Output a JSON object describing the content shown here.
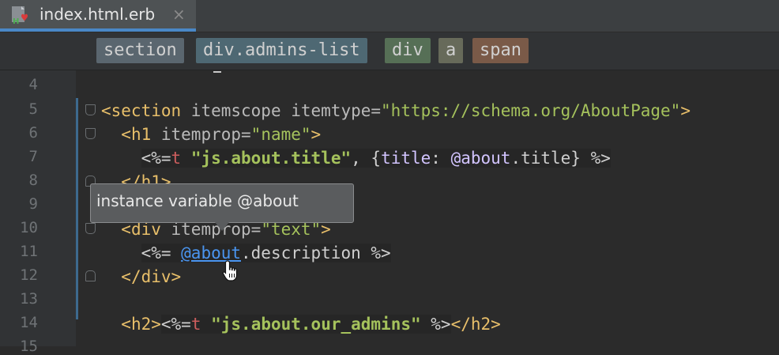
{
  "tab": {
    "title": "index.html.erb",
    "close": "×",
    "icon": "erb-file-icon"
  },
  "breadcrumbs": [
    {
      "label": "section",
      "bg": "#5a666f"
    },
    {
      "label": "div.admins-list",
      "bg": "#4e6873"
    },
    {
      "label": "div",
      "bg": "#566f56"
    },
    {
      "label": "a",
      "bg": "#676a5a"
    },
    {
      "label": "span",
      "bg": "#7a5a48"
    }
  ],
  "line_numbers": [
    "4",
    "5",
    "6",
    "7",
    "8",
    "9",
    "10",
    "11",
    "12",
    "13",
    "14",
    "15"
  ],
  "code": {
    "l5": {
      "open": "<section",
      "attr": " itemscope itemtype=",
      "val": "\"https://schema.org/AboutPage\"",
      "close": ">"
    },
    "l6": {
      "indent": "  ",
      "open": "<h1",
      "attr": " itemprop=",
      "val": "\"name\"",
      "close": ">"
    },
    "l7": {
      "indent": "    ",
      "erb_open": "<%=",
      "method": "t",
      "sp": " ",
      "str": "\"js.about.title\"",
      "comma": ", {",
      "key": "title",
      "colon": ": ",
      "ivar": "@about",
      "dot": ".title}",
      "erb_close": " %>"
    },
    "l8": {
      "indent": "  ",
      "text": "</h1>"
    },
    "l10": {
      "indent": "  ",
      "open": "<div",
      "attr": " itemprop=",
      "val": "\"text\"",
      "close": ">"
    },
    "l11": {
      "indent": "    ",
      "erb_open": "<%= ",
      "ivar": "@about",
      "rest": ".description ",
      "erb_close": "%>"
    },
    "l12": {
      "indent": "  ",
      "text": "</div>"
    },
    "l14": {
      "indent": "  ",
      "open": "<h2>",
      "erb_open": "<%=",
      "method": "t",
      "sp": " ",
      "str": "\"js.about.our_admins\"",
      "erb_close": " %>",
      "close": "</h2>"
    }
  },
  "tooltip": {
    "text": "instance variable @about"
  },
  "colors": {
    "accent": "#4a88c7",
    "tag": "#e8bf6a",
    "string": "#a5c25c",
    "method": "#cc5d5d",
    "ivar": "#d2c4ff",
    "link": "#4a95f0"
  }
}
